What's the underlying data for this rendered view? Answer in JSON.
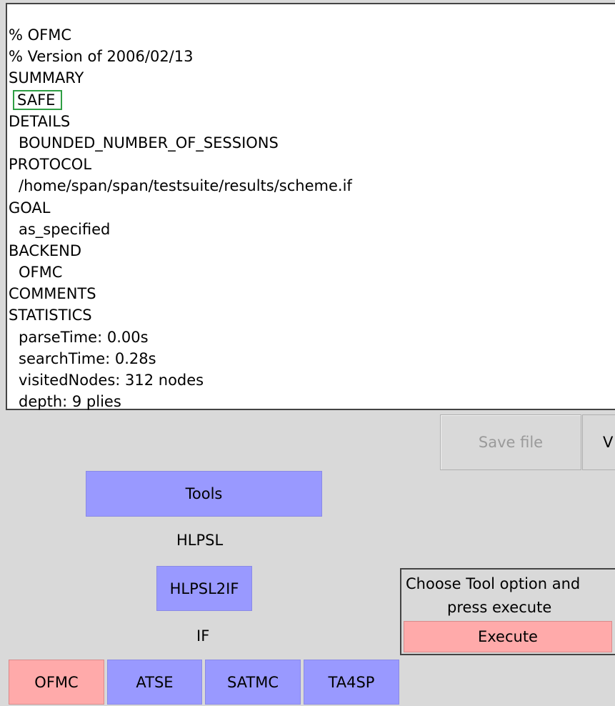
{
  "output": {
    "lines": [
      {
        "text": "% OFMC"
      },
      {
        "text": "% Version of 2006/02/13"
      },
      {
        "text": "SUMMARY"
      },
      {
        "text": "SAFE"
      },
      {
        "text": "DETAILS"
      },
      {
        "text": "BOUNDED_NUMBER_OF_SESSIONS"
      },
      {
        "text": "PROTOCOL"
      },
      {
        "text": "/home/span/span/testsuite/results/scheme.if"
      },
      {
        "text": "GOAL"
      },
      {
        "text": "as_specified"
      },
      {
        "text": "BACKEND"
      },
      {
        "text": "OFMC"
      },
      {
        "text": "COMMENTS"
      },
      {
        "text": "STATISTICS"
      },
      {
        "text": "parseTime: 0.00s"
      },
      {
        "text": "searchTime: 0.28s"
      },
      {
        "text": "visitedNodes: 312 nodes"
      },
      {
        "text": "depth: 9 plies"
      }
    ]
  },
  "toolbar": {
    "save_label": "Save file",
    "view_label": "V"
  },
  "tools": {
    "tools_label": "Tools",
    "hlpsl_label": "HLPSL",
    "hlpsl2if_label": "HLPSL2IF",
    "if_label": "IF",
    "backends": [
      {
        "label": "OFMC",
        "selected": true
      },
      {
        "label": "ATSE",
        "selected": false
      },
      {
        "label": "SATMC",
        "selected": false
      },
      {
        "label": "TA4SP",
        "selected": false
      }
    ]
  },
  "execute_panel": {
    "instruction_line1": "Choose Tool option and",
    "instruction_line2": "press execute",
    "execute_label": "Execute"
  },
  "colors": {
    "tool_button": "#9999ff",
    "selected_button": "#ffaaaa",
    "safe_highlight": "#2f9e44",
    "panel_bg": "#d9d9d9"
  }
}
